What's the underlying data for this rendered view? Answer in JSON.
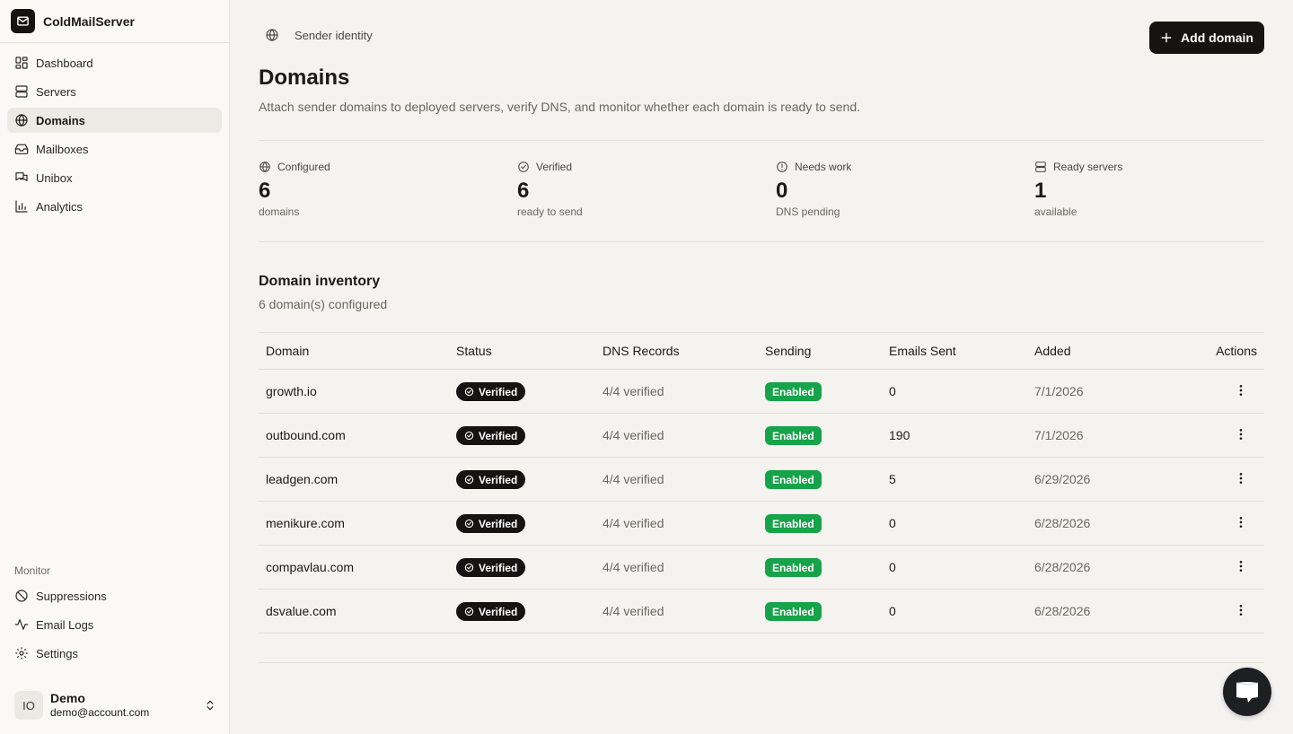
{
  "brand": {
    "name": "ColdMailServer"
  },
  "nav": {
    "items": [
      {
        "label": "Dashboard",
        "icon": "dashboard-icon"
      },
      {
        "label": "Servers",
        "icon": "server-icon"
      },
      {
        "label": "Domains",
        "icon": "globe-icon",
        "active": true
      },
      {
        "label": "Mailboxes",
        "icon": "inbox-icon"
      },
      {
        "label": "Unibox",
        "icon": "messages-icon"
      },
      {
        "label": "Analytics",
        "icon": "chart-icon"
      }
    ],
    "monitor_label": "Monitor",
    "monitor_items": [
      {
        "label": "Suppressions",
        "icon": "ban-icon"
      },
      {
        "label": "Email Logs",
        "icon": "activity-icon"
      },
      {
        "label": "Settings",
        "icon": "gear-icon"
      }
    ]
  },
  "user": {
    "initials": "IO",
    "name": "Demo",
    "email": "demo@account.com"
  },
  "header": {
    "breadcrumb": "Sender identity",
    "add_label": "Add domain",
    "title": "Domains",
    "description": "Attach sender domains to deployed servers, verify DNS, and monitor whether each domain is ready to send."
  },
  "stats": [
    {
      "label": "Configured",
      "value": "6",
      "sub": "domains",
      "icon": "globe-icon"
    },
    {
      "label": "Verified",
      "value": "6",
      "sub": "ready to send",
      "icon": "check-circle-icon"
    },
    {
      "label": "Needs work",
      "value": "0",
      "sub": "DNS pending",
      "icon": "alert-circle-icon"
    },
    {
      "label": "Ready servers",
      "value": "1",
      "sub": "available",
      "icon": "server-icon"
    }
  ],
  "inventory": {
    "title": "Domain inventory",
    "subtitle": "6 domain(s) configured",
    "columns": [
      "Domain",
      "Status",
      "DNS Records",
      "Sending",
      "Emails Sent",
      "Added",
      "Actions"
    ],
    "rows": [
      {
        "domain": "growth.io",
        "status": "Verified",
        "dns": "4/4 verified",
        "sending": "Enabled",
        "emails": "0",
        "added": "7/1/2026"
      },
      {
        "domain": "outbound.com",
        "status": "Verified",
        "dns": "4/4 verified",
        "sending": "Enabled",
        "emails": "190",
        "added": "7/1/2026"
      },
      {
        "domain": "leadgen.com",
        "status": "Verified",
        "dns": "4/4 verified",
        "sending": "Enabled",
        "emails": "5",
        "added": "6/29/2026"
      },
      {
        "domain": "menikure.com",
        "status": "Verified",
        "dns": "4/4 verified",
        "sending": "Enabled",
        "emails": "0",
        "added": "6/28/2026"
      },
      {
        "domain": "compavlau.com",
        "status": "Verified",
        "dns": "4/4 verified",
        "sending": "Enabled",
        "emails": "0",
        "added": "6/28/2026"
      },
      {
        "domain": "dsvalue.com",
        "status": "Verified",
        "dns": "4/4 verified",
        "sending": "Enabled",
        "emails": "0",
        "added": "6/28/2026"
      }
    ]
  },
  "colors": {
    "accent": "#151413",
    "enabled": "#17a34a",
    "background": "#f5f3ef",
    "sidebar": "#faf9f6"
  }
}
